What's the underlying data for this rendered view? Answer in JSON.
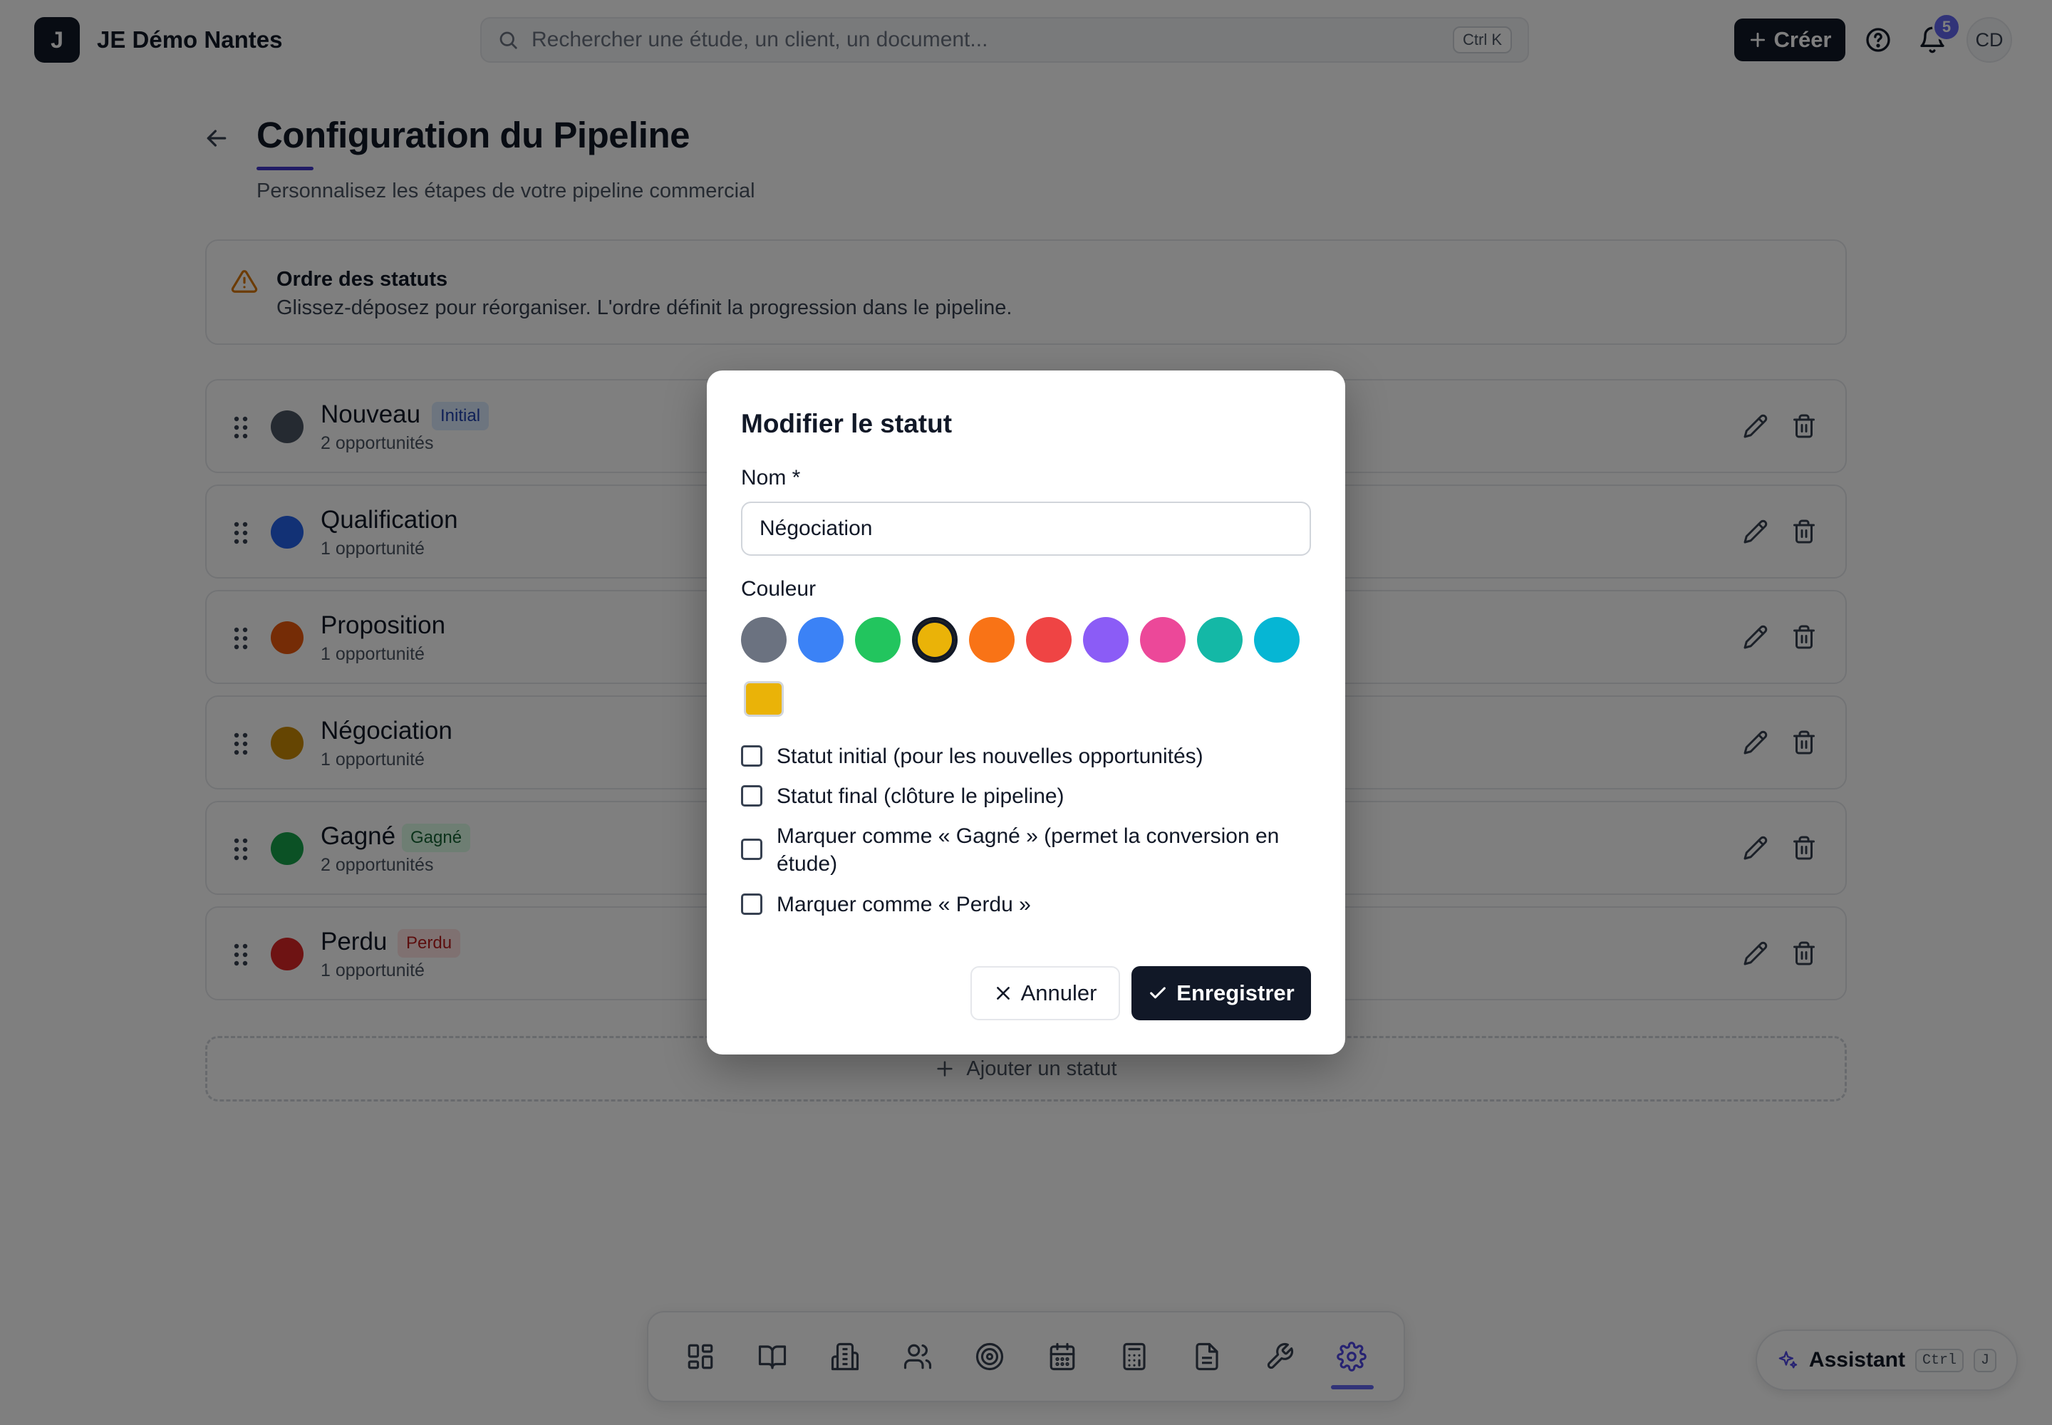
{
  "app": {
    "logo_letter": "J",
    "name": "JE Démo Nantes"
  },
  "search": {
    "placeholder": "Rechercher une étude, un client, un document...",
    "shortcut": "Ctrl K"
  },
  "header": {
    "create_label": "Créer",
    "notification_count": "5",
    "avatar_initials": "CD"
  },
  "page": {
    "title": "Configuration du Pipeline",
    "subtitle": "Personnalisez les étapes de votre pipeline commercial"
  },
  "info": {
    "title": "Ordre des statuts",
    "text": "Glissez-déposez pour réorganiser. L'ordre définit la progression dans le pipeline."
  },
  "statuses": [
    {
      "name": "Nouveau",
      "count": "2 opportunités",
      "color": "#4b5563",
      "tag": "Initial"
    },
    {
      "name": "Qualification",
      "count": "1 opportunité",
      "color": "#2563eb",
      "tag": ""
    },
    {
      "name": "Proposition",
      "count": "1 opportunité",
      "color": "#ea580c",
      "tag": ""
    },
    {
      "name": "Négociation",
      "count": "1 opportunité",
      "color": "#ca8a04",
      "tag": ""
    },
    {
      "name": "Gagné",
      "count": "2 opportunités",
      "color": "#16a34a",
      "tag": "Gagné"
    },
    {
      "name": "Perdu",
      "count": "1 opportunité",
      "color": "#dc2626",
      "tag": "Perdu"
    }
  ],
  "add_status_label": "Ajouter un statut",
  "dock": {
    "items": [
      "dashboard-icon",
      "book-icon",
      "building-icon",
      "users-icon",
      "target-icon",
      "calendar-icon",
      "calculator-icon",
      "document-icon",
      "wrench-icon",
      "gear-icon"
    ],
    "active": "gear-icon"
  },
  "assistant": {
    "label": "Assistant",
    "shortcut_mod": "Ctrl",
    "shortcut_key": "J"
  },
  "modal": {
    "title": "Modifier le statut",
    "name_label": "Nom *",
    "name_value": "Négociation",
    "color_label": "Couleur",
    "colors": [
      "#6b7280",
      "#3b82f6",
      "#22c55e",
      "#eab308",
      "#f97316",
      "#ef4444",
      "#8b5cf6",
      "#ec4899",
      "#14b8a6",
      "#06b6d4"
    ],
    "selected_color": "#eab308",
    "checkboxes": [
      {
        "label": "Statut initial (pour les nouvelles opportunités)",
        "checked": false
      },
      {
        "label": "Statut final (clôture le pipeline)",
        "checked": false
      },
      {
        "label": "Marquer comme « Gagné » (permet la conversion en étude)",
        "checked": false
      },
      {
        "label": "Marquer comme « Perdu »",
        "checked": false
      }
    ],
    "cancel_label": "Annuler",
    "save_label": "Enregistrer"
  }
}
